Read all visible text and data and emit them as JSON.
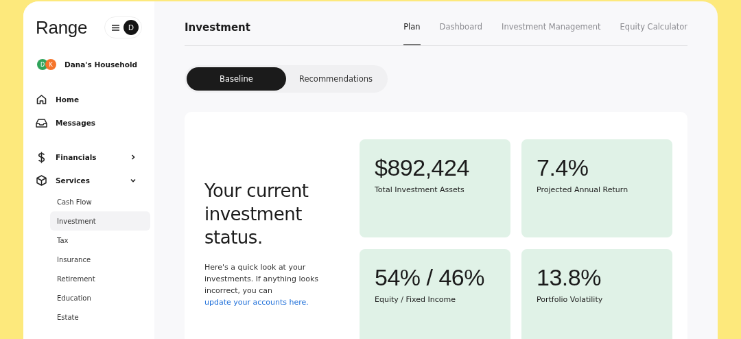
{
  "brand": "Range",
  "menu_avatar": "D",
  "household": {
    "name": "Dana's Household",
    "members": [
      {
        "initial": "D",
        "color": "#2fa35a"
      },
      {
        "initial": "K",
        "color": "#f5742a"
      }
    ]
  },
  "nav": [
    {
      "label": "Home",
      "kind": "link"
    },
    {
      "label": "Messages",
      "kind": "link"
    },
    {
      "label": "Financials",
      "kind": "group",
      "expanded": false
    },
    {
      "label": "Services",
      "kind": "group",
      "expanded": true,
      "children": [
        {
          "label": "Cash Flow",
          "selected": false
        },
        {
          "label": "Investment",
          "selected": true
        },
        {
          "label": "Tax",
          "selected": false
        },
        {
          "label": "Insurance",
          "selected": false
        },
        {
          "label": "Retirement",
          "selected": false
        },
        {
          "label": "Education",
          "selected": false
        },
        {
          "label": "Estate",
          "selected": false
        }
      ]
    }
  ],
  "page_title": "Investment",
  "tabs": [
    {
      "label": "Plan",
      "selected": true
    },
    {
      "label": "Dashboard",
      "selected": false
    },
    {
      "label": "Investment Management",
      "selected": false
    },
    {
      "label": "Equity Calculator",
      "selected": false
    }
  ],
  "segments": [
    {
      "label": "Baseline",
      "selected": true
    },
    {
      "label": "Recommendations",
      "selected": false
    }
  ],
  "intro": {
    "heading": "Your current investment status.",
    "text": "Here's a quick look at your investments. If anything looks incorrect, you can",
    "link": "update your accounts here."
  },
  "stats": [
    {
      "value": "$892,424",
      "label": "Total Investment Assets"
    },
    {
      "value": "7.4%",
      "label": "Projected Annual Return"
    },
    {
      "value": "54% / 46%",
      "label": "Equity / Fixed Income"
    },
    {
      "value": "13.8%",
      "label": "Portfolio Volatility"
    }
  ]
}
